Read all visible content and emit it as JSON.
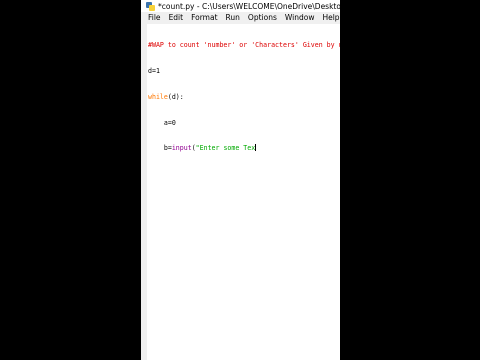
{
  "window": {
    "title": "*count.py - C:\\Users\\WELCOME\\OneDrive\\Desktop\\Pyth"
  },
  "menu": [
    {
      "first": "F",
      "rest": "ile"
    },
    {
      "first": "E",
      "rest": "dit"
    },
    {
      "first": "F",
      "rest": "o",
      "pre": "",
      "full": "Format"
    },
    {
      "first": "R",
      "rest": "un"
    },
    {
      "first": "O",
      "rest": "ptions"
    },
    {
      "first": "W",
      "rest": "indow"
    },
    {
      "first": "H",
      "rest": "elp"
    }
  ],
  "menu_labels": [
    "File",
    "Edit",
    "Format",
    "Run",
    "Options",
    "Window",
    "Help"
  ],
  "code": {
    "line1": "#WAP to count 'number' or 'Characters' Given by user",
    "line2": "d=1",
    "line3_kw": "while",
    "line3_rest": "(d):",
    "line4": "    a=0",
    "line5_pre": "    b=",
    "line5_bi": "input",
    "line5_paren": "(",
    "line5_str": "\"Enter some Tex"
  },
  "colors": {
    "comment": "#dd0000",
    "keyword": "#ff7700",
    "builtin": "#900090",
    "string": "#00aa00"
  }
}
